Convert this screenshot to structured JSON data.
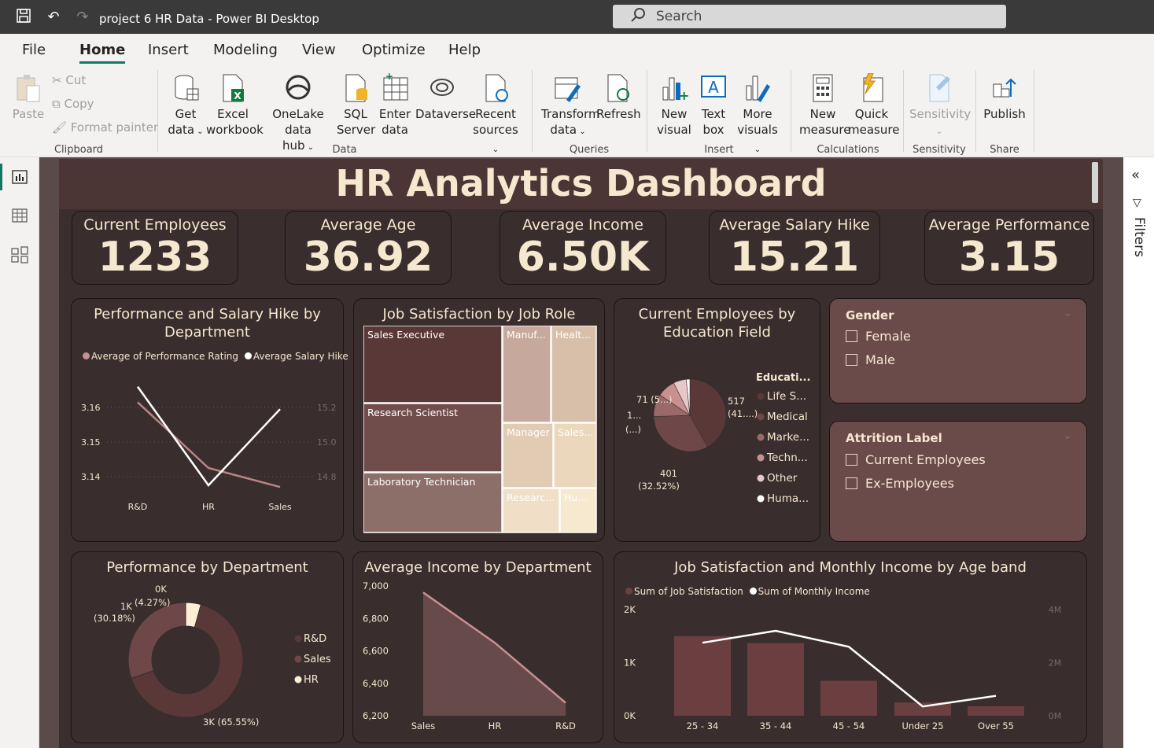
{
  "titlebar": {
    "app_title": "project 6 HR Data - Power BI Desktop",
    "search_placeholder": "Search"
  },
  "menu": [
    "File",
    "Home",
    "Insert",
    "Modeling",
    "View",
    "Optimize",
    "Help"
  ],
  "ribbon": {
    "clipboard": {
      "paste": "Paste",
      "cut": "Cut",
      "copy": "Copy",
      "format_painter": "Format painter",
      "group": "Clipboard"
    },
    "data": {
      "get_data": [
        "Get",
        "data"
      ],
      "excel": [
        "Excel",
        "workbook"
      ],
      "onelake": [
        "OneLake data",
        "hub"
      ],
      "sql": [
        "SQL",
        "Server"
      ],
      "enter": [
        "Enter",
        "data"
      ],
      "dataverse": "Dataverse",
      "recent": [
        "Recent",
        "sources"
      ],
      "group": "Data"
    },
    "queries": {
      "transform": [
        "Transform",
        "data"
      ],
      "refresh": "Refresh",
      "group": "Queries"
    },
    "insert": {
      "new_visual": [
        "New",
        "visual"
      ],
      "text_box": [
        "Text",
        "box"
      ],
      "more_visuals": [
        "More",
        "visuals"
      ],
      "group": "Insert"
    },
    "calculations": {
      "new_measure": [
        "New",
        "measure"
      ],
      "quick_measure": [
        "Quick",
        "measure"
      ],
      "group": "Calculations"
    },
    "sensitivity": {
      "label": "Sensitivity",
      "group": "Sensitivity"
    },
    "share": {
      "publish": "Publish",
      "group": "Share"
    }
  },
  "filters_pane": {
    "label": "Filters"
  },
  "dashboard": {
    "title": "HR Analytics Dashboard",
    "kpis": [
      {
        "label": "Current Employees",
        "value": "1233"
      },
      {
        "label": "Average Age",
        "value": "36.92"
      },
      {
        "label": "Average Income",
        "value": "6.50K"
      },
      {
        "label": "Average Salary Hike",
        "value": "15.21"
      },
      {
        "label": "Average Performance",
        "value": "3.15"
      }
    ],
    "panels": {
      "perf_salary": {
        "title": [
          "Performance and Salary Hike by",
          "Department"
        ],
        "legend": [
          "Average of Performance Rating",
          "Average Salary Hike"
        ]
      },
      "job_sat": {
        "title": "Job Satisfaction by Job Role"
      },
      "education": {
        "title": [
          "Current Employees by",
          "Education Field"
        ],
        "legend_title": "Educati...",
        "legend": [
          "Life S...",
          "Medical",
          "Marke...",
          "Techn...",
          "Other",
          "Huma..."
        ],
        "labels": {
          "a": "517",
          "a2": "(41....)",
          "b": "401",
          "b2": "(32.52%)",
          "c": "71 (5...)",
          "d": "1...",
          "d2": "(...)"
        }
      },
      "gender": {
        "title": "Gender",
        "items": [
          "Female",
          "Male"
        ]
      },
      "attrition": {
        "title": "Attrition Label",
        "items": [
          "Current Employees",
          "Ex-Employees"
        ]
      },
      "perf_dept": {
        "title": "Performance by Department",
        "legend": [
          "R&D",
          "Sales",
          "HR"
        ],
        "labels": {
          "top": "0K",
          "top2": "(4.27%)",
          "left": "1K",
          "left2": "(30.18%)",
          "bottom": "3K (65.55%)"
        }
      },
      "avg_income": {
        "title": "Average Income by Department"
      },
      "age_band": {
        "title": "Job Satisfaction and Monthly Income by Age band",
        "legend": [
          "Sum of Job Satisfaction",
          "Sum of Monthly Income"
        ]
      }
    }
  },
  "chart_data": [
    {
      "type": "line",
      "title": "Performance and Salary Hike by Department",
      "categories": [
        "R&D",
        "HR",
        "Sales"
      ],
      "series": [
        {
          "name": "Average of Performance Rating",
          "values": [
            3.1615,
            3.1425,
            3.137
          ],
          "axis": "left"
        },
        {
          "name": "Average Salary Hike",
          "values": [
            15.32,
            14.75,
            15.19
          ],
          "axis": "right"
        }
      ],
      "y_left": {
        "ticks": [
          "3.16",
          "3.15",
          "3.14"
        ],
        "range": [
          3.135,
          3.165
        ]
      },
      "y_right": {
        "ticks": [
          "15.2",
          "15.0",
          "14.8"
        ],
        "range": [
          14.7,
          15.3
        ]
      }
    },
    {
      "type": "treemap",
      "title": "Job Satisfaction by Job Role",
      "items": [
        {
          "label": "Sales Executive"
        },
        {
          "label": "Research Scientist"
        },
        {
          "label": "Laboratory Technician"
        },
        {
          "label": "Manuf..."
        },
        {
          "label": "Healt..."
        },
        {
          "label": "Manager"
        },
        {
          "label": "Sales..."
        },
        {
          "label": "Researc..."
        },
        {
          "label": "Hu..."
        }
      ]
    },
    {
      "type": "pie",
      "title": "Current Employees by Education Field",
      "slices": [
        {
          "name": "Life S...",
          "value": 517
        },
        {
          "name": "Medical",
          "value": 401
        },
        {
          "name": "Marke...",
          "value": 124
        },
        {
          "name": "Techn...",
          "value": 100
        },
        {
          "name": "Other",
          "value": 71
        },
        {
          "name": "Huma...",
          "value": 20
        }
      ]
    },
    {
      "type": "pie",
      "title": "Performance by Department",
      "slices": [
        {
          "name": "R&D",
          "value": 65.55
        },
        {
          "name": "Sales",
          "value": 30.18
        },
        {
          "name": "HR",
          "value": 4.27
        }
      ]
    },
    {
      "type": "area",
      "title": "Average Income by Department",
      "categories": [
        "Sales",
        "HR",
        "R&D"
      ],
      "values": [
        6960,
        6650,
        6280
      ],
      "y_ticks": [
        "7,000",
        "6,800",
        "6,600",
        "6,400",
        "6,200"
      ],
      "ylim": [
        6200,
        7000
      ]
    },
    {
      "type": "bar",
      "title": "Job Satisfaction and Monthly Income by Age band",
      "categories": [
        "25 - 34",
        "35 - 44",
        "45 - 54",
        "Under 25",
        "Over 55"
      ],
      "series": [
        {
          "name": "Sum of Job Satisfaction",
          "type": "bar",
          "values": [
            1500,
            1370,
            660,
            250,
            180
          ]
        },
        {
          "name": "Sum of Monthly Income",
          "type": "line",
          "values": [
            2750000,
            3200000,
            2600000,
            350000,
            750000
          ]
        }
      ],
      "y_left": {
        "ticks": [
          "2K",
          "1K",
          "0K"
        ],
        "range": [
          0,
          2000
        ]
      },
      "y_right": {
        "ticks": [
          "4M",
          "2M",
          "0M"
        ],
        "range": [
          0,
          4000000
        ]
      }
    }
  ]
}
